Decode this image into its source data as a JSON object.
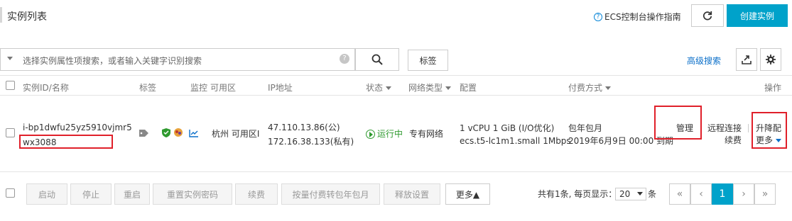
{
  "header": {
    "title": "实例列表",
    "guide_link": "ECS控制台操作指南",
    "create_button": "创建实例"
  },
  "toolbar": {
    "search_placeholder": "选择实例属性项搜索，或者输入关键字识别搜索",
    "tag_button": "标签",
    "advanced_search": "高级搜索"
  },
  "table": {
    "columns": {
      "id_name": "实例ID/名称",
      "tags": "标签",
      "monitor": "监控",
      "zone": "可用区",
      "ip": "IP地址",
      "status": "状态",
      "network": "网络类型",
      "config": "配置",
      "billing": "付费方式",
      "actions": "操作"
    },
    "rows": [
      {
        "instance_id": "i-bp1dwfu25yz5910vjmr5",
        "name": "wx3088",
        "zone": "杭州 可用区I",
        "public_ip": "47.110.13.86(公)",
        "private_ip": "172.16.38.133(私有)",
        "status": "运行中",
        "network": "专有网络",
        "config_line1": "1 vCPU 1 GiB (I/O优化)",
        "config_line2": "ecs.t5-lc1m1.small   1Mbps",
        "billing_line1": "包年包月",
        "billing_line2": "2019年6月9日 00:00 到期",
        "action_manage": "管理",
        "action_remote1": "远程连接",
        "action_remote2": "续费",
        "action_upgrade": "升降配",
        "action_more": "更多"
      }
    ]
  },
  "footer": {
    "buttons": [
      "启动",
      "停止",
      "重启",
      "重置实例密码",
      "续费",
      "按量付费转包年包月",
      "释放设置"
    ],
    "more": "更多▲",
    "summary": "共有1条, 每页显示：",
    "page_size": "20",
    "page_size_suffix": "条",
    "pager": [
      "«",
      "‹",
      "1",
      "›",
      "»"
    ]
  },
  "colors": {
    "accent": "#00a2ca",
    "link": "#0b6fc9",
    "running": "#2f9a2f",
    "highlight": "#e0202a"
  }
}
